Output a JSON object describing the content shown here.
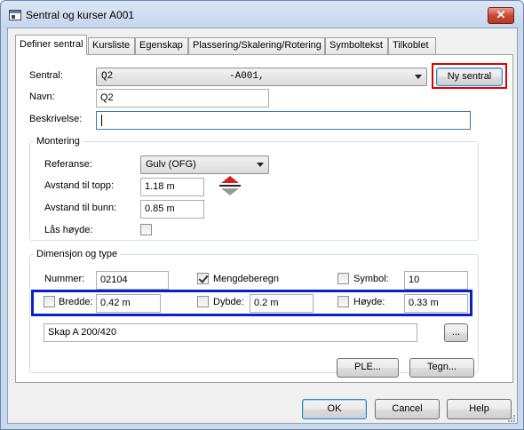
{
  "window": {
    "title": "Sentral og kurser  A001",
    "close_glyph": "✕"
  },
  "tabs": [
    {
      "label": "Definer sentral",
      "active": true
    },
    {
      "label": "Kursliste"
    },
    {
      "label": "Egenskap"
    },
    {
      "label": "Plassering/Skalering/Rotering"
    },
    {
      "label": "Symboltekst"
    },
    {
      "label": "Tilkoblet"
    }
  ],
  "sentral": {
    "label": "Sentral:",
    "selected_left": "Q2",
    "selected_right": "-A001,",
    "new_button": "Ny sentral"
  },
  "navn": {
    "label": "Navn:",
    "value": "Q2"
  },
  "beskrivelse": {
    "label": "Beskrivelse:",
    "value": ""
  },
  "montering": {
    "title": "Montering",
    "referanse_label": "Referanse:",
    "referanse_value": "Gulv (OFG)",
    "topp_label": "Avstand til topp:",
    "topp_value": "1.18 m",
    "bunn_label": "Avstand til bunn:",
    "bunn_value": "0.85 m",
    "las_label": "Lås høyde:",
    "las_checked": false
  },
  "dimensjon": {
    "title": "Dimensjon og type",
    "nummer_label": "Nummer:",
    "nummer_value": "02104",
    "mengde_label": "Mengdeberegn",
    "mengde_checked": true,
    "symbol_label": "Symbol:",
    "symbol_checked": false,
    "symbol_value": "10",
    "bredde_label": "Bredde:",
    "bredde_value": "0.42 m",
    "dybde_label": "Dybde:",
    "dybde_value": "0.2 m",
    "hoyde_label": "Høyde:",
    "hoyde_value": "0.33 m",
    "type_value": "Skap A 200/420",
    "browse_label": "..."
  },
  "panel_buttons": {
    "ple": "PLE...",
    "tegn": "Tegn..."
  },
  "dialog_buttons": {
    "ok": "OK",
    "cancel": "Cancel",
    "help": "Help"
  },
  "colors": {
    "highlight_red": "#e00000",
    "highlight_blue": "#0a20c8",
    "arrow_red": "#d42020"
  },
  "icons": [
    "app-icon",
    "close-icon",
    "dropdown-arrow-icon",
    "height-adjust-icon",
    "checkbox-icon"
  ]
}
